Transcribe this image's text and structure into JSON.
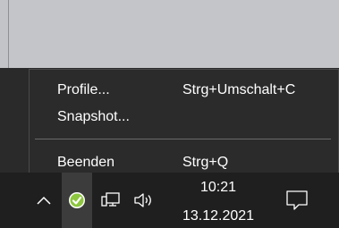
{
  "menu": {
    "items": [
      {
        "label": "Profile...",
        "shortcut": "Strg+Umschalt+C"
      },
      {
        "label": "Snapshot...",
        "shortcut": ""
      },
      {
        "label": "Beenden",
        "shortcut": "Strg+Q"
      }
    ]
  },
  "tray": {
    "icons": [
      "chevron-up-icon",
      "app-check-icon",
      "network-icon",
      "volume-icon",
      "notification-icon"
    ],
    "app_icon_color": "#8dc63f"
  },
  "clock": {
    "time": "10:21",
    "date": "13.12.2021"
  },
  "colors": {
    "menu_bg": "#2b2b2b",
    "taskbar_bg": "#1f1f1f",
    "text": "#ffffff"
  }
}
